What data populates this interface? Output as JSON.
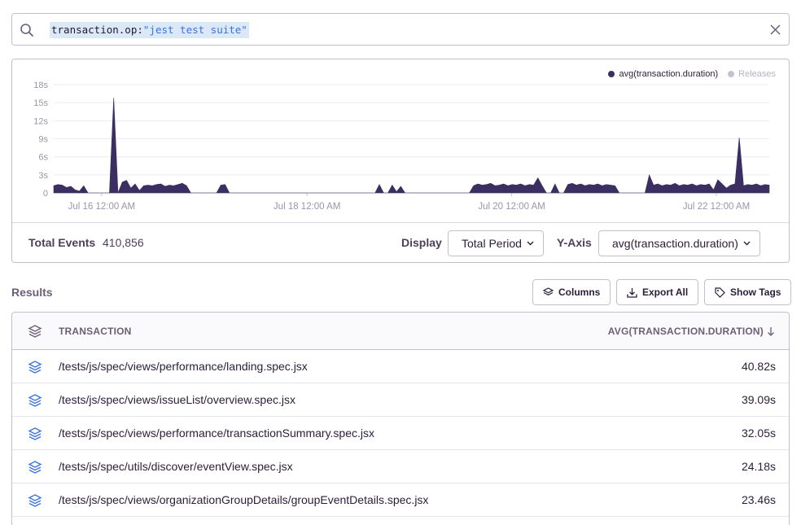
{
  "search": {
    "query_key": "transaction.op:",
    "query_value": "\"jest test suite\""
  },
  "legend": {
    "series_label": "avg(transaction.duration)",
    "releases_label": "Releases",
    "series_color": "#3b2f62",
    "releases_color": "#c6c0cf"
  },
  "chart_data": {
    "type": "area",
    "y_ticks": [
      "0",
      "3s",
      "6s",
      "9s",
      "12s",
      "15s",
      "18s"
    ],
    "ylim": [
      0,
      18
    ],
    "x_ticks": [
      "Jul 16 12:00 AM",
      "Jul 18 12:00 AM",
      "Jul 20 12:00 AM",
      "Jul 22 12:00 AM"
    ],
    "series": [
      {
        "name": "avg(transaction.duration)",
        "color": "#3b2f62",
        "values": [
          1.2,
          1.4,
          1.3,
          0.9,
          1.1,
          0.5,
          0.3,
          1.2,
          0,
          0,
          0,
          0,
          0,
          0,
          15.8,
          0,
          1.8,
          2.1,
          0.8,
          1.5,
          0.4,
          1.2,
          1.3,
          1.2,
          1.4,
          1.5,
          1.1,
          1.3,
          1.2,
          1.4,
          1.6,
          1.2,
          0,
          0,
          0,
          0,
          0,
          0,
          0,
          1.3,
          1.4,
          0,
          0,
          0,
          0,
          0,
          0,
          0,
          0,
          0,
          0,
          0,
          0,
          0,
          0,
          0,
          0,
          0,
          0,
          0,
          0,
          0,
          0,
          0,
          0,
          0,
          0,
          0,
          0,
          0,
          0,
          0,
          0,
          0,
          0,
          0,
          1.4,
          0,
          0,
          1.3,
          0.2,
          1.1,
          0,
          0,
          0,
          0,
          0,
          0,
          0,
          0,
          0,
          0,
          0,
          0,
          0,
          0,
          0,
          0,
          1.2,
          1.5,
          1.3,
          1.4,
          1.6,
          1.2,
          1.3,
          1.5,
          1.2,
          1.4,
          1.3,
          1.5,
          1.2,
          1.4,
          1.3,
          2.5,
          1.2,
          0,
          0,
          1.5,
          0,
          0,
          1.4,
          1.6,
          1.3,
          1.5,
          1.2,
          1.4,
          1.3,
          1.5,
          1.2,
          1.4,
          1.3,
          1.2,
          0,
          0,
          0,
          0,
          0,
          0,
          0,
          3.0,
          1.3,
          1.5,
          1.2,
          1.4,
          1.3,
          1.6,
          1.2,
          1.4,
          1.3,
          1.5,
          1.2,
          1.4,
          1.3,
          1.5,
          0.5,
          2.2,
          1.5,
          0.8,
          1.3,
          1.5,
          9.2,
          1.2,
          1.4,
          1.3,
          1.5,
          1.2,
          1.4,
          1.3
        ]
      }
    ],
    "grid": true,
    "legend_position": "top-right"
  },
  "footer": {
    "total_label": "Total Events",
    "total_value": "410,856",
    "display_label": "Display",
    "display_value": "Total Period",
    "yaxis_label": "Y-Axis",
    "yaxis_value": "avg(transaction.duration)"
  },
  "results": {
    "title": "Results",
    "columns_btn": "Columns",
    "export_btn": "Export All",
    "tags_btn": "Show Tags"
  },
  "table": {
    "col_name": "TRANSACTION",
    "col_value": "AVG(TRANSACTION.DURATION)",
    "rows": [
      {
        "name": "/tests/js/spec/views/performance/landing.spec.jsx",
        "value": "40.82s"
      },
      {
        "name": "/tests/js/spec/views/issueList/overview.spec.jsx",
        "value": "39.09s"
      },
      {
        "name": "/tests/js/spec/views/performance/transactionSummary.spec.jsx",
        "value": "32.05s"
      },
      {
        "name": "/tests/js/spec/utils/discover/eventView.spec.jsx",
        "value": "24.18s"
      },
      {
        "name": "/tests/js/spec/views/organizationGroupDetails/groupEventDetails.spec.jsx",
        "value": "23.46s"
      }
    ]
  }
}
